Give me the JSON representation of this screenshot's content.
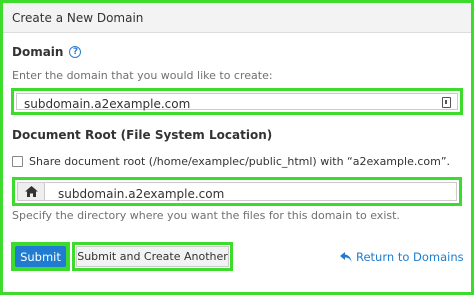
{
  "header": {
    "title": "Create a New Domain"
  },
  "domain": {
    "label": "Domain",
    "help_icon": "?",
    "hint": "Enter the domain that you would like to create:",
    "value": "subdomain.a2example.com"
  },
  "document_root": {
    "label": "Document Root (File System Location)",
    "share_label": "Share document root (/home/examplec/public_html) with “a2example.com”.",
    "share_checked": false,
    "value": "subdomain.a2example.com",
    "hint": "Specify the directory where you want the files for this domain to exist."
  },
  "actions": {
    "submit_label": "Submit",
    "submit_another_label": "Submit and Create Another",
    "return_label": "Return to Domains"
  },
  "colors": {
    "highlight": "#3ddb2c",
    "primary": "#1f7cd1"
  },
  "icons": {
    "help": "question-circle-icon",
    "field": "lock-icon",
    "home": "home-icon",
    "return": "return-arrow-icon"
  }
}
